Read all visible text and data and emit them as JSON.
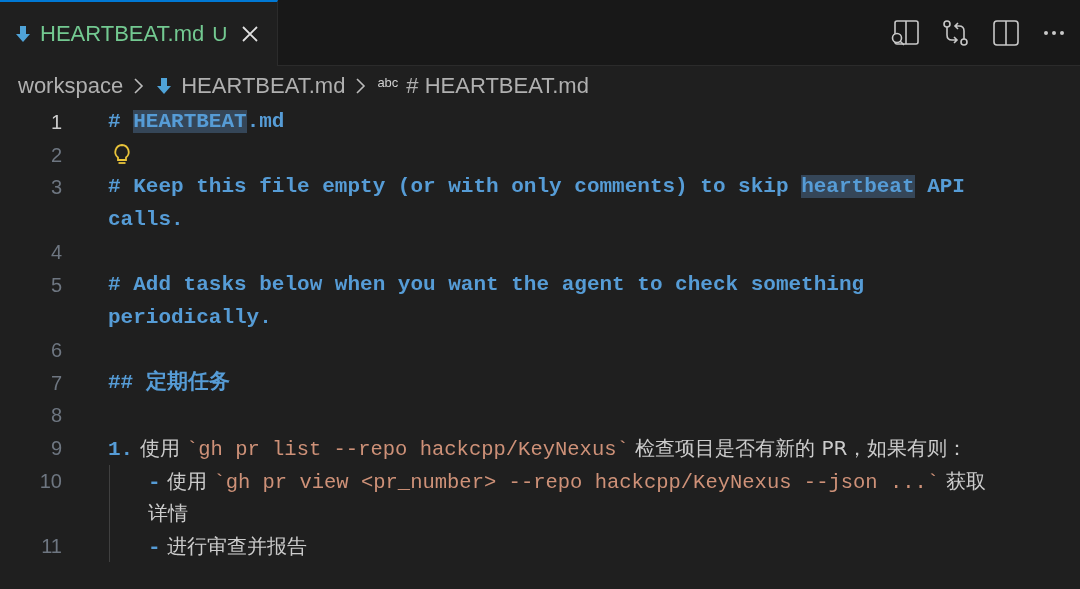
{
  "tabs": [
    {
      "label": "HEARTBEAT.md",
      "status": "U",
      "selected": true
    }
  ],
  "breadcrumb": [
    {
      "kind": "folder",
      "label": "workspace"
    },
    {
      "kind": "file",
      "label": "HEARTBEAT.md"
    },
    {
      "kind": "symbol",
      "badge": "abc",
      "label": "# HEARTBEAT.md"
    }
  ],
  "lines": [
    {
      "number": "1",
      "current": true,
      "rows": [
        [
          {
            "kind": "heading",
            "text": "# "
          },
          {
            "kind": "highlight",
            "text": "HEARTBEAT"
          },
          {
            "kind": "heading",
            "text": ".md"
          }
        ]
      ]
    },
    {
      "number": "2",
      "current": false,
      "lightbulb": true
    },
    {
      "number": "3",
      "current": false,
      "rows": [
        [
          {
            "kind": "heading",
            "text": "# Keep this file empty (or with only comments) to skip "
          },
          {
            "kind": "highlight",
            "text": "heartbeat"
          },
          {
            "kind": "heading",
            "text": " API"
          }
        ],
        [
          {
            "kind": "heading",
            "text": "calls."
          }
        ]
      ]
    },
    {
      "number": "4",
      "current": false
    },
    {
      "number": "5",
      "current": false,
      "rows": [
        [
          {
            "kind": "heading",
            "text": "# Add tasks below when you want the agent to check something"
          }
        ],
        [
          {
            "kind": "heading",
            "text": "periodically."
          }
        ]
      ]
    },
    {
      "number": "6",
      "current": false
    },
    {
      "number": "7",
      "current": false,
      "rows": [
        [
          {
            "kind": "heading",
            "text": "## 定期任务"
          }
        ]
      ]
    },
    {
      "number": "8",
      "current": false
    },
    {
      "number": "9",
      "current": false,
      "rows": [
        [
          {
            "kind": "marker",
            "text": "1."
          },
          {
            "kind": "text",
            "text": " 使用 "
          },
          {
            "kind": "code",
            "text": "`gh pr list --repo hackcpp/KeyNexus`"
          },
          {
            "kind": "text",
            "text": " 检查项目是否有新的 PR，如果有则："
          }
        ]
      ]
    },
    {
      "number": "10",
      "current": false,
      "indent": true,
      "rows": [
        [
          {
            "kind": "marker",
            "text": "-"
          },
          {
            "kind": "text",
            "text": " 使用 "
          },
          {
            "kind": "code",
            "text": "`gh pr view <pr_number> --repo hackcpp/KeyNexus --json ...`"
          },
          {
            "kind": "text",
            "text": " 获取"
          }
        ],
        [
          {
            "kind": "text",
            "text": "详情"
          }
        ]
      ]
    },
    {
      "number": "11",
      "current": false,
      "indent": true,
      "rows": [
        [
          {
            "kind": "marker",
            "text": "-"
          },
          {
            "kind": "text",
            "text": " 进行审查并报告"
          }
        ]
      ]
    }
  ]
}
